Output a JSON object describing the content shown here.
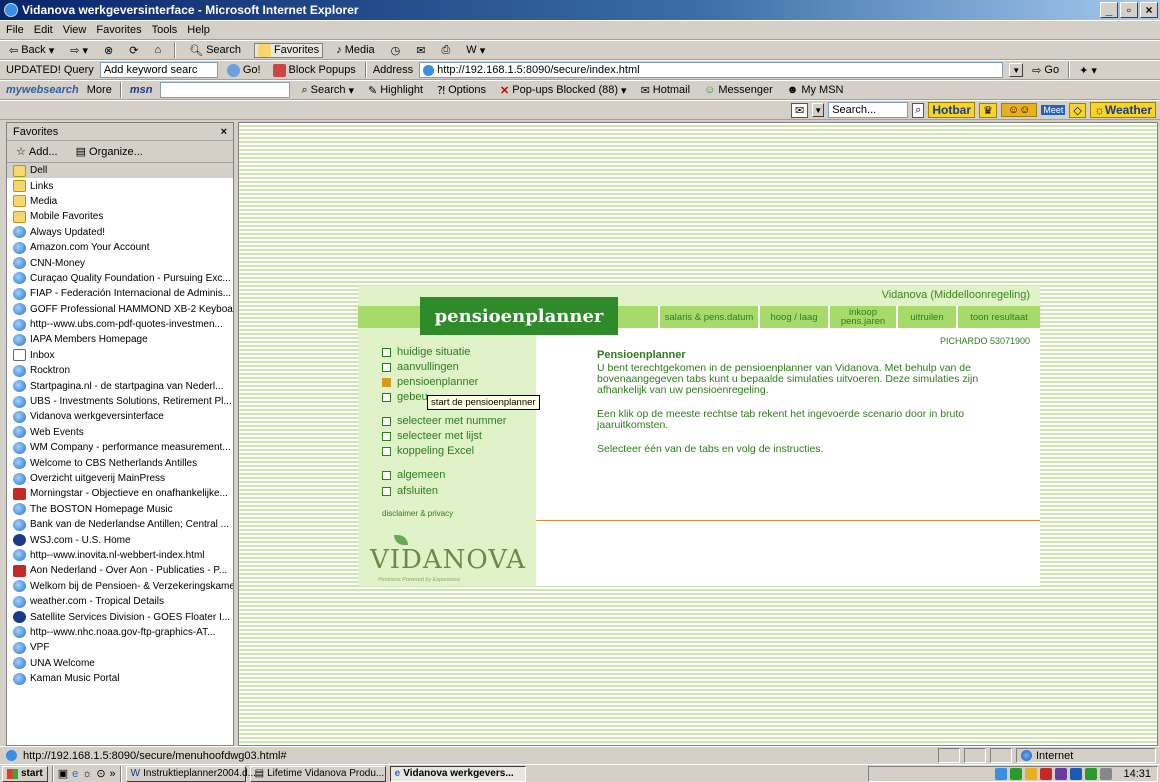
{
  "window": {
    "title": "Vidanova werkgeversinterface - Microsoft Internet Explorer"
  },
  "menu": [
    "File",
    "Edit",
    "View",
    "Favorites",
    "Tools",
    "Help"
  ],
  "toolbar": {
    "back": "Back",
    "search": "Search",
    "favorites": "Favorites",
    "media": "Media"
  },
  "querybar": {
    "updated": "UPDATED! Query",
    "keyword_placeholder": "Add keyword searc",
    "go": "Go!",
    "block_popups": "Block Popups",
    "address_label": "Address",
    "address": "http://192.168.1.5:8090/secure/index.html",
    "go_btn": "Go"
  },
  "msnbar": {
    "mywebsearch": "mywebsearch",
    "more": "More",
    "msn": "msn",
    "search": "Search",
    "highlight": "Highlight",
    "options": "Options",
    "popups": "Pop-ups Blocked (88)",
    "hotmail": "Hotmail",
    "messenger": "Messenger",
    "mymsn": "My MSN"
  },
  "hotbar": {
    "search_placeholder": "Search...",
    "hotbar": "Hotbar",
    "meet": "Meet",
    "weather": "Weather"
  },
  "sidebar": {
    "title": "Favorites",
    "add": "Add...",
    "organize": "Organize...",
    "items": [
      {
        "label": "Dell",
        "icon": "folder"
      },
      {
        "label": "Links",
        "icon": "folder"
      },
      {
        "label": "Media",
        "icon": "folder"
      },
      {
        "label": "Mobile Favorites",
        "icon": "folder"
      },
      {
        "label": "Always Updated!",
        "icon": "page"
      },
      {
        "label": "Amazon.com Your Account",
        "icon": "page"
      },
      {
        "label": "CNN-Money",
        "icon": "page"
      },
      {
        "label": "Curaçao Quality Foundation - Pursuing Exc...",
        "icon": "page"
      },
      {
        "label": "FIAP - Federación Internacional de Adminis...",
        "icon": "page"
      },
      {
        "label": "GOFF Professional HAMMOND XB-2 Keyboard",
        "icon": "page"
      },
      {
        "label": "http--www.ubs.com-pdf-quotes-investmen...",
        "icon": "page"
      },
      {
        "label": "IAPA Members Homepage",
        "icon": "page"
      },
      {
        "label": "Inbox",
        "icon": "mail"
      },
      {
        "label": "Rocktron",
        "icon": "page"
      },
      {
        "label": "Startpagina.nl - de startpagina van Nederl...",
        "icon": "page"
      },
      {
        "label": "UBS - Investments Solutions, Retirement Pl...",
        "icon": "page"
      },
      {
        "label": "Vidanova werkgeversinterface",
        "icon": "page"
      },
      {
        "label": "Web Events",
        "icon": "page"
      },
      {
        "label": "WM Company - performance measurement...",
        "icon": "page"
      },
      {
        "label": "Welcome to CBS Netherlands Antilles",
        "icon": "page"
      },
      {
        "label": "Overzicht uitgeverij MainPress",
        "icon": "page"
      },
      {
        "label": "Morningstar - Objectieve en onafhankelijke...",
        "icon": "red"
      },
      {
        "label": "The BOSTON Homepage Music",
        "icon": "page"
      },
      {
        "label": "Bank van de Nederlandse Antillen; Central ...",
        "icon": "page"
      },
      {
        "label": "WSJ.com - U.S. Home",
        "icon": "blue"
      },
      {
        "label": "http--www.inovita.nl-webbert-index.html",
        "icon": "page"
      },
      {
        "label": "Aon Nederland - Over Aon - Publicaties - P...",
        "icon": "red"
      },
      {
        "label": "Welkom bij de Pensioen- & Verzekeringskamer",
        "icon": "page"
      },
      {
        "label": "weather.com - Tropical Details",
        "icon": "page"
      },
      {
        "label": "Satellite Services Division - GOES Floater I...",
        "icon": "blue"
      },
      {
        "label": "http--www.nhc.noaa.gov-ftp-graphics-AT...",
        "icon": "page"
      },
      {
        "label": "VPF",
        "icon": "page"
      },
      {
        "label": "UNA Welcome",
        "icon": "page"
      },
      {
        "label": "Kaman Music Portal",
        "icon": "page"
      }
    ]
  },
  "vidanova": {
    "title": "Vidanova (Middelloonregeling)",
    "app_tab": "pensioenplanner",
    "tabs": [
      "salaris & pens.datum",
      "hoog / laag",
      "inkoop pens.jaren",
      "uitruilen",
      "toon resultaat"
    ],
    "id": "PICHARDO  53071900",
    "menu": [
      "huidige situatie",
      "aanvullingen",
      "pensioenplanner",
      "gebeu",
      "selecteer met nummer",
      "selecteer met lijst",
      "koppeling Excel",
      "algemeen",
      "afsluiten"
    ],
    "tooltip": "start de pensioenplanner",
    "disclaimer": "disclaimer & privacy",
    "heading": "Pensioenplanner",
    "p1": "U bent terechtgekomen in de pensioenplanner van Vidanova. Met behulp van de bovenaangegeven tabs kunt u bepaalde simulaties uitvoeren. Deze simulaties zijn afhankelijk van uw pensioenregeling.",
    "p2": "Een klik op de meeste rechtse tab rekent het ingevoerde scenario door in bruto jaaruitkomsten.",
    "p3": "Selecteer één van de tabs en volg de instructies.",
    "logo": "VIDANOVA",
    "logo_sub": "Pensions Powered by Experience"
  },
  "status": {
    "url": "http://192.168.1.5:8090/secure/menuhoofdwg03.html#",
    "zone": "Internet"
  },
  "taskbar": {
    "start": "start",
    "tasks": [
      "Instruktieplanner2004.d...",
      "Lifetime Vidanova Produ...",
      "Vidanova werkgevers..."
    ],
    "time": "14:31"
  }
}
